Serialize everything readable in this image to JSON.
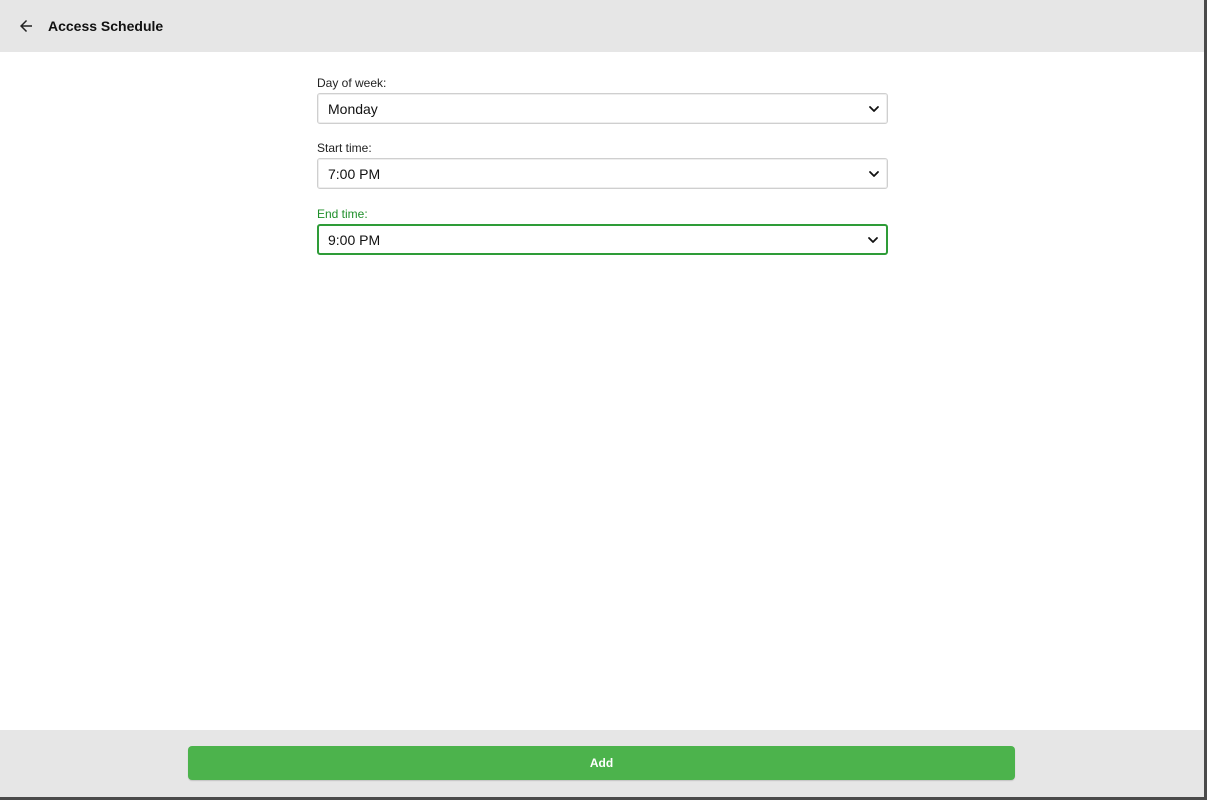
{
  "header": {
    "title": "Access Schedule",
    "back_icon": "arrow-left-icon"
  },
  "form": {
    "day_of_week": {
      "label": "Day of week:",
      "value": "Monday"
    },
    "start_time": {
      "label": "Start time:",
      "value": "7:00 PM"
    },
    "end_time": {
      "label": "End time:",
      "value": "9:00 PM"
    }
  },
  "footer": {
    "add_label": "Add"
  },
  "colors": {
    "accent": "#4cb34c",
    "focus": "#2e9c38",
    "header_bg": "#e6e6e6"
  }
}
